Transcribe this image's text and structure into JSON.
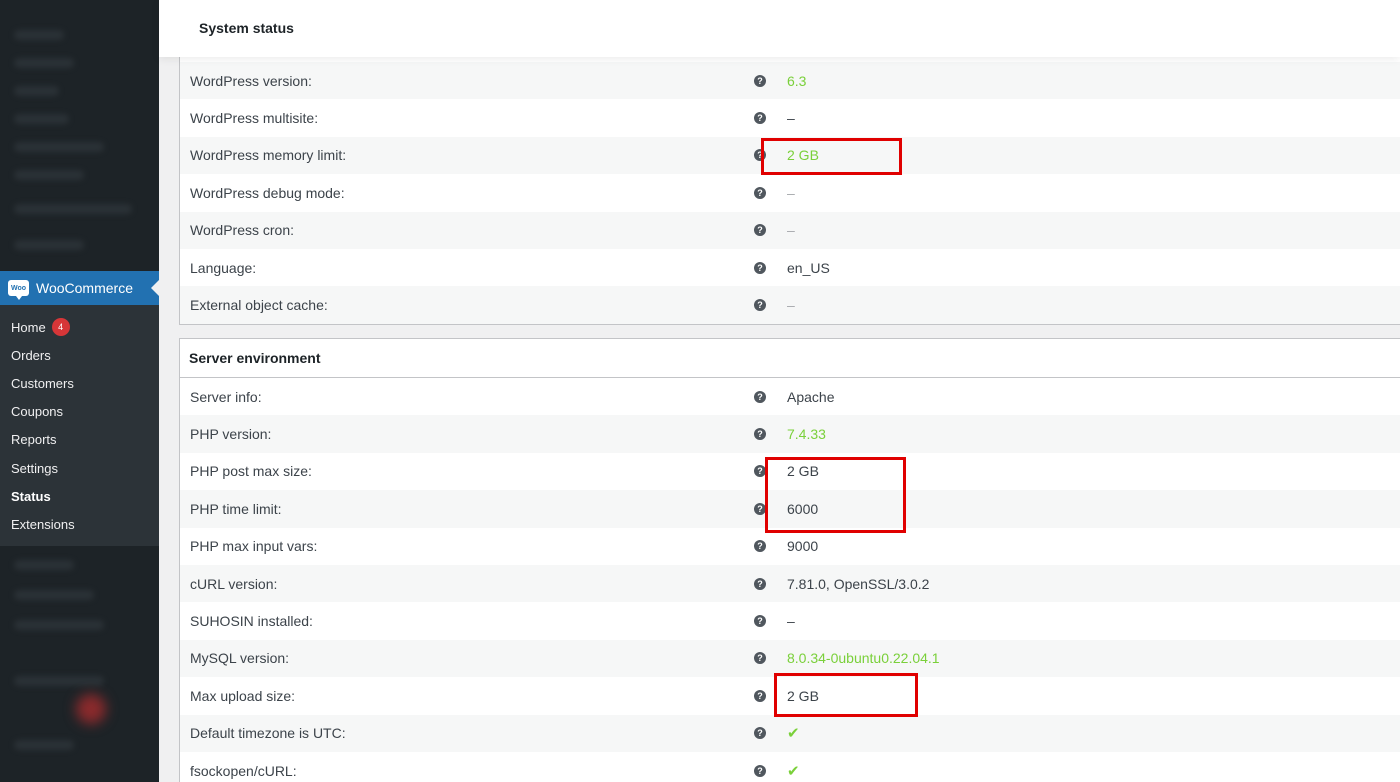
{
  "header": {
    "title": "System status"
  },
  "sidebar": {
    "woocommerce_label": "WooCommerce",
    "woo_logo_text": "Woo",
    "items": [
      {
        "label": "Home",
        "badge": "4"
      },
      {
        "label": "Orders"
      },
      {
        "label": "Customers"
      },
      {
        "label": "Coupons"
      },
      {
        "label": "Reports"
      },
      {
        "label": "Settings"
      },
      {
        "label": "Status"
      },
      {
        "label": "Extensions"
      }
    ]
  },
  "help_icon_glyph": "?",
  "wordpress_env": {
    "rows": [
      {
        "label": "WordPress version:",
        "value": "6.3",
        "status": "ok"
      },
      {
        "label": "WordPress multisite:",
        "value": "–",
        "status": "plain"
      },
      {
        "label": "WordPress memory limit:",
        "value": "2 GB",
        "status": "ok"
      },
      {
        "label": "WordPress debug mode:",
        "value": "–",
        "status": "dash"
      },
      {
        "label": "WordPress cron:",
        "value": "–",
        "status": "dash"
      },
      {
        "label": "Language:",
        "value": "en_US",
        "status": "plain"
      },
      {
        "label": "External object cache:",
        "value": "–",
        "status": "dash"
      }
    ]
  },
  "server_env": {
    "title": "Server environment",
    "rows": [
      {
        "label": "Server info:",
        "value": "Apache",
        "status": "plain"
      },
      {
        "label": "PHP version:",
        "value": "7.4.33",
        "status": "ok"
      },
      {
        "label": "PHP post max size:",
        "value": "2 GB",
        "status": "plain"
      },
      {
        "label": "PHP time limit:",
        "value": "6000",
        "status": "plain"
      },
      {
        "label": "PHP max input vars:",
        "value": "9000",
        "status": "plain"
      },
      {
        "label": "cURL version:",
        "value": "7.81.0, OpenSSL/3.0.2",
        "status": "plain"
      },
      {
        "label": "SUHOSIN installed:",
        "value": "–",
        "status": "plain"
      },
      {
        "label": "MySQL version:",
        "value": "8.0.34-0ubuntu0.22.04.1",
        "status": "ok"
      },
      {
        "label": "Max upload size:",
        "value": "2 GB",
        "status": "plain"
      },
      {
        "label": "Default timezone is UTC:",
        "value": "✔",
        "status": "check"
      },
      {
        "label": "fsockopen/cURL:",
        "value": "✔",
        "status": "check"
      }
    ]
  },
  "colors": {
    "sidebar_bg": "#1d2327",
    "active_menu": "#2271b1",
    "ok_green": "#7ad03a",
    "highlight_red": "#e00000"
  }
}
